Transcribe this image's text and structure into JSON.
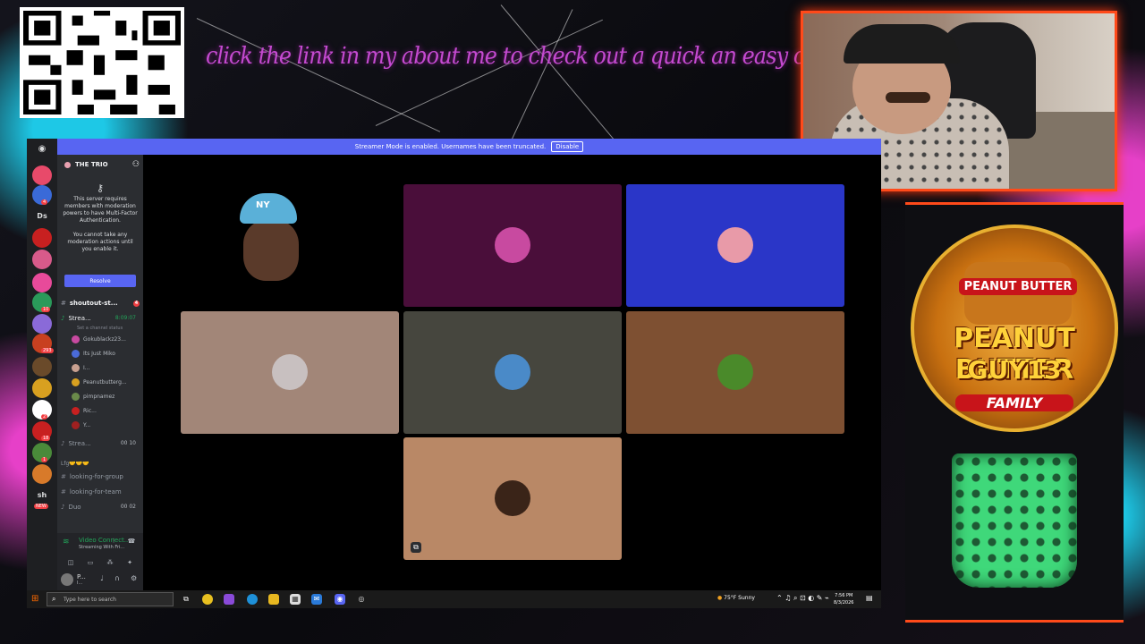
{
  "overlay": {
    "banner": "click the link in my about me to check out a quick an easy come up!",
    "logo": {
      "jar_label": "PEANUT BUTTER",
      "line1": "PEANUT BUTTER",
      "line2": "GUY13",
      "family": "FAMILY"
    }
  },
  "discord": {
    "strip": {
      "message": "Streamer Mode is enabled. Usernames have been truncated.",
      "button": "Disable"
    },
    "server": {
      "name": "THE TRIO",
      "chevron": "⌄",
      "invite_icon": "person-add-icon"
    },
    "rail": {
      "servers": [
        {
          "color": "#e84a6a"
        },
        {
          "color": "#3a6ad8",
          "badge": "4"
        },
        {
          "text": "Ds"
        },
        {
          "color": "#c82020"
        },
        {
          "color": "#d85a8a"
        },
        {
          "color": "#e84a9a"
        },
        {
          "color": "#2a9a5a",
          "badge": "10"
        },
        {
          "color": "#8a6ad8"
        },
        {
          "color": "#c84020",
          "badge": "293"
        },
        {
          "color": "#6a4a2a"
        },
        {
          "color": "#d8a020"
        },
        {
          "color": "#ffffff",
          "badge": "2"
        },
        {
          "color": "#c82020",
          "badge": "18"
        },
        {
          "color": "#4a8a3a",
          "badge": "1"
        },
        {
          "color": "#d87a2a"
        },
        {
          "text": "sh"
        }
      ],
      "new_badge": "NEW"
    },
    "mfa": {
      "text1": "This server requires members with moderation powers to have Multi-Factor Authentication.",
      "text2": "You cannot take any moderation actions until you enable it.",
      "button": "Resolve"
    },
    "channels": {
      "shoutout": {
        "name": "shoutout-st...",
        "badge": "4"
      },
      "stream": {
        "name": "Strea...",
        "time": "8:09:07",
        "status": "Set a channel status"
      },
      "users": [
        {
          "name": "Gokublackz23...",
          "color": "#c84aa0"
        },
        {
          "name": "Its Just Miko",
          "color": "#4a6ad8"
        },
        {
          "name": "I...",
          "color": "#c8a090"
        },
        {
          "name": "Peanutbutterg...",
          "color": "#d8a020"
        },
        {
          "name": "pimpnamez",
          "color": "#6a8a4a"
        },
        {
          "name": "Ric...",
          "color": "#c82020"
        },
        {
          "name": "Y...",
          "color": "#a02020"
        }
      ],
      "stream2": {
        "name": "Strea...",
        "count": "00 10"
      },
      "category": "Lfg🤝🤝🤝",
      "lfg": "looking-for-group",
      "lft": "looking-for-team",
      "duo": {
        "name": "Duo",
        "count": "00 02"
      }
    },
    "voice": {
      "title": "Video Connect...",
      "subtitle": "Streaming With Fri..."
    },
    "me": {
      "name": "P...",
      "status": "I..."
    },
    "tiles": [
      {
        "type": "camera",
        "label": "NY"
      },
      {
        "color": "#4a0e3a",
        "avatar": "#c84aa0"
      },
      {
        "color": "#2a36c8",
        "avatar": "#e89aa8"
      },
      {
        "color": "#a28678",
        "avatar": "#c8c0c0"
      },
      {
        "color": "#46463e",
        "avatar": "#4a8ac8"
      },
      {
        "color": "#7e5032",
        "avatar": "#4a8a2a"
      },
      {
        "color": "#b98866",
        "avatar": "#3a2418"
      }
    ]
  },
  "taskbar": {
    "search_placeholder": "Type here to search",
    "weather": "75°F  Sunny",
    "time": "7:56 PM",
    "date": "8/3/2026"
  }
}
